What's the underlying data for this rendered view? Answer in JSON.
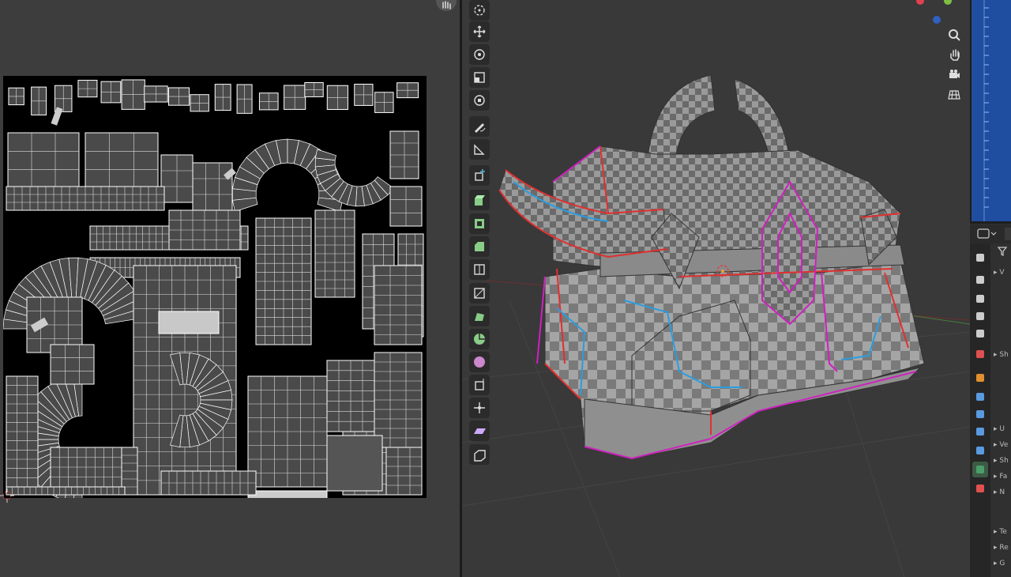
{
  "uv_editor": {
    "hand_icon": "hand-icon"
  },
  "toolbar": {
    "tools": [
      {
        "name": "select-box",
        "icon": "select-circle-icon"
      },
      {
        "name": "cursor",
        "icon": "move-arrows-icon"
      },
      {
        "name": "rotate",
        "icon": "rotate-icon"
      },
      {
        "name": "scale",
        "icon": "scale-icon"
      },
      {
        "name": "transform",
        "icon": "transform-icon"
      },
      {
        "name": "annotate",
        "icon": "annotate-icon"
      },
      {
        "name": "measure",
        "icon": "measure-icon"
      },
      {
        "name": "add-cube",
        "icon": "add-cube-icon"
      },
      {
        "name": "extrude",
        "icon": "extrude-icon"
      },
      {
        "name": "inset",
        "icon": "inset-icon"
      },
      {
        "name": "bevel",
        "icon": "bevel-icon"
      },
      {
        "name": "loop-cut",
        "icon": "loop-cut-icon"
      },
      {
        "name": "knife",
        "icon": "knife-icon"
      },
      {
        "name": "poly-build",
        "icon": "poly-build-icon"
      },
      {
        "name": "spin",
        "icon": "spin-icon"
      },
      {
        "name": "smooth",
        "icon": "smooth-icon"
      },
      {
        "name": "edge-slide",
        "icon": "edge-slide-icon"
      },
      {
        "name": "shrink-fatten",
        "icon": "shrink-fatten-icon"
      },
      {
        "name": "shear",
        "icon": "shear-icon"
      },
      {
        "name": "rip",
        "icon": "rip-icon"
      }
    ]
  },
  "navigation": [
    {
      "name": "zoom",
      "icon": "zoom-icon"
    },
    {
      "name": "pan",
      "icon": "hand-icon"
    },
    {
      "name": "camera",
      "icon": "camera-icon"
    },
    {
      "name": "ortho",
      "icon": "grid-icon"
    }
  ],
  "properties": {
    "tabs": [
      "tool",
      "render",
      "output",
      "view-layer",
      "scene",
      "world",
      "object",
      "modifiers",
      "particles",
      "physics",
      "constraints",
      "data",
      "material"
    ],
    "panel_items": [
      {
        "label": "V"
      },
      {
        "label": "Sh"
      },
      {
        "label": "U"
      },
      {
        "label": "Ve"
      },
      {
        "label": "Sh"
      },
      {
        "label": "Fa"
      },
      {
        "label": "N"
      },
      {
        "label": "Te"
      },
      {
        "label": "Re"
      },
      {
        "label": "G"
      }
    ]
  },
  "colors": {
    "seam_red": "#e03030",
    "seam_blue": "#2a9de0",
    "seam_magenta": "#d020c0",
    "outliner_selection": "#1f4ea0",
    "active_tab": "#4a9e6a"
  }
}
